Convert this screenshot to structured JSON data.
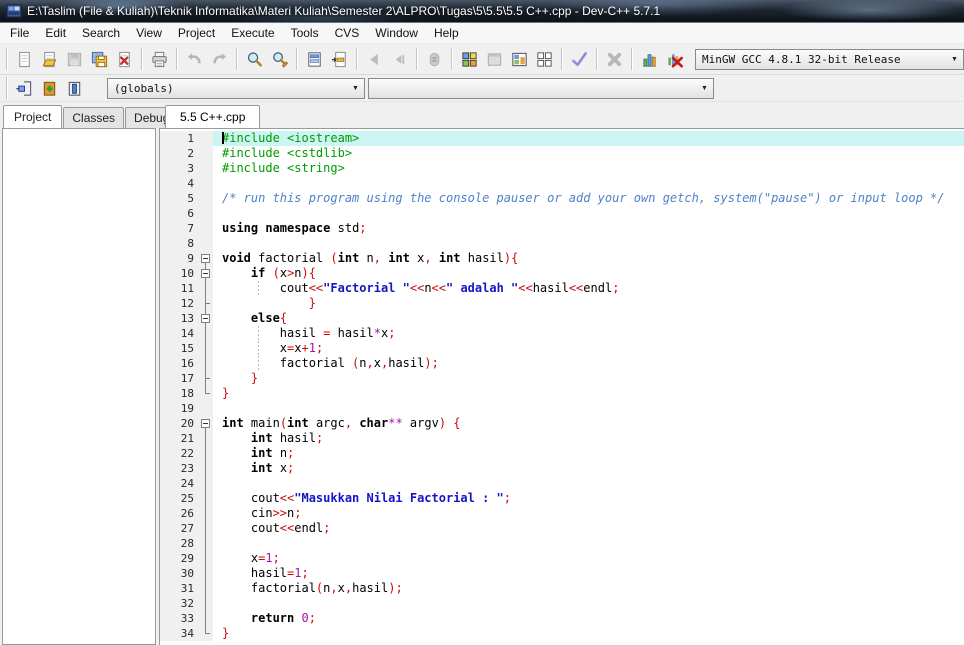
{
  "window": {
    "title": "E:\\Taslim (File & Kuliah)\\Teknik Informatika\\Materi Kuliah\\Semester 2\\ALPRO\\Tugas\\5\\5.5\\5.5 C++.cpp - Dev-C++ 5.7.1"
  },
  "menu": {
    "items": [
      "File",
      "Edit",
      "Search",
      "View",
      "Project",
      "Execute",
      "Tools",
      "CVS",
      "Window",
      "Help"
    ]
  },
  "toolbar": {
    "groups": [
      [
        "new-file-icon",
        "open-file-icon",
        "save-icon",
        "save-all-icon",
        "close-file-icon"
      ],
      [
        "print-icon"
      ],
      [
        "undo-icon",
        "redo-icon"
      ],
      [
        "find-icon",
        "replace-icon"
      ],
      [
        "goto-line-icon",
        "insert-icon"
      ],
      [
        "back-icon",
        "forward-icon"
      ],
      [
        "debug-icon"
      ],
      [
        "compile-icon",
        "run-icon",
        "compile-run-icon",
        "rebuild-all-icon"
      ],
      [
        "syntax-check-icon"
      ],
      [
        "abort-icon"
      ],
      [
        "profile-icon",
        "delete-profiling-icon"
      ]
    ],
    "compiler_select": "MinGW GCC 4.8.1 32-bit Release"
  },
  "project_toolbar": {
    "groups": [
      [
        "new-source-icon",
        "add-to-project-icon",
        "remove-from-project-icon"
      ]
    ]
  },
  "class_browser": {
    "scope": "(globals)",
    "member": ""
  },
  "panel_tabs": [
    {
      "label": "Project",
      "active": true
    },
    {
      "label": "Classes",
      "active": false
    },
    {
      "label": "Debug",
      "active": false
    }
  ],
  "editor_tabs": [
    {
      "label": "5.5 C++.cpp",
      "active": true
    }
  ],
  "colors": {
    "gutter_bg": "#f0f0f0",
    "active_line_bg": "#ccf4f2",
    "line_number": "#282828",
    "fold_mark": "#808080",
    "syntax_preprocessor": "#009b00",
    "syntax_comment": "#4f81c9",
    "syntax_keyword": "#000000",
    "syntax_string": "#1414c8",
    "syntax_operator": "#cc0a0a",
    "syntax_number": "#a810a8"
  },
  "editor": {
    "lines": [
      {
        "hl": true,
        "caret": true,
        "s": [
          [
            "pp",
            "#include <iostream>"
          ]
        ]
      },
      {
        "s": [
          [
            "pp",
            "#include <cstdlib>"
          ]
        ]
      },
      {
        "s": [
          [
            "pp",
            "#include <string>"
          ]
        ]
      },
      {
        "s": []
      },
      {
        "s": [
          [
            "cm",
            "/* run this program using the console pauser or add your own getch, system(\"pause\") or input loop */"
          ]
        ]
      },
      {
        "s": []
      },
      {
        "s": [
          [
            "kw",
            "using"
          ],
          [
            "pl",
            " "
          ],
          [
            "kw",
            "namespace"
          ],
          [
            "pl",
            " std"
          ],
          [
            "op",
            ";"
          ]
        ]
      },
      {
        "s": []
      },
      {
        "f": "b",
        "s": [
          [
            "kw",
            "void"
          ],
          [
            "pl",
            " factorial "
          ],
          [
            "op",
            "("
          ],
          [
            "kw",
            "int"
          ],
          [
            "pl",
            " n"
          ],
          [
            "op",
            ","
          ],
          [
            "pl",
            " "
          ],
          [
            "kw",
            "int"
          ],
          [
            "pl",
            " x"
          ],
          [
            "op",
            ","
          ],
          [
            "pl",
            " "
          ],
          [
            "kw",
            "int"
          ],
          [
            "pl",
            " hasil"
          ],
          [
            "op",
            "){"
          ]
        ]
      },
      {
        "f": "b",
        "s": [
          [
            "pl",
            "    "
          ],
          [
            "kw",
            "if"
          ],
          [
            "pl",
            " "
          ],
          [
            "op",
            "("
          ],
          [
            "pl",
            "x"
          ],
          [
            "op",
            ">"
          ],
          [
            "pl",
            "n"
          ],
          [
            "op",
            "){"
          ]
        ]
      },
      {
        "f": "v",
        "g": true,
        "s": [
          [
            "pl",
            "        cout"
          ],
          [
            "op",
            "<<"
          ],
          [
            "st",
            "\"Factorial \""
          ],
          [
            "op",
            "<<"
          ],
          [
            "pl",
            "n"
          ],
          [
            "op",
            "<<"
          ],
          [
            "st",
            "\" adalah \""
          ],
          [
            "op",
            "<<"
          ],
          [
            "pl",
            "hasil"
          ],
          [
            "op",
            "<<"
          ],
          [
            "pl",
            "endl"
          ],
          [
            "op",
            ";"
          ]
        ]
      },
      {
        "f": "t",
        "s": [
          [
            "pl",
            "            "
          ],
          [
            "op",
            "}"
          ]
        ]
      },
      {
        "f": "b",
        "s": [
          [
            "pl",
            "    "
          ],
          [
            "kw",
            "else"
          ],
          [
            "op",
            "{"
          ]
        ]
      },
      {
        "f": "v",
        "g": true,
        "s": [
          [
            "pl",
            "        hasil "
          ],
          [
            "op",
            "="
          ],
          [
            "pl",
            " hasil"
          ],
          [
            "nu",
            "*"
          ],
          [
            "pl",
            "x"
          ],
          [
            "op",
            ";"
          ]
        ]
      },
      {
        "f": "v",
        "g": true,
        "s": [
          [
            "pl",
            "        x"
          ],
          [
            "op",
            "="
          ],
          [
            "pl",
            "x"
          ],
          [
            "op",
            "+"
          ],
          [
            "nu",
            "1"
          ],
          [
            "op",
            ";"
          ]
        ]
      },
      {
        "f": "v",
        "g": true,
        "s": [
          [
            "pl",
            "        factorial "
          ],
          [
            "op",
            "("
          ],
          [
            "pl",
            "n"
          ],
          [
            "op",
            ","
          ],
          [
            "pl",
            "x"
          ],
          [
            "op",
            ","
          ],
          [
            "pl",
            "hasil"
          ],
          [
            "op",
            ");"
          ]
        ]
      },
      {
        "f": "t",
        "s": [
          [
            "pl",
            "    "
          ],
          [
            "op",
            "}"
          ]
        ]
      },
      {
        "f": "e",
        "s": [
          [
            "op",
            "}"
          ]
        ]
      },
      {
        "s": []
      },
      {
        "f": "b",
        "s": [
          [
            "kw",
            "int"
          ],
          [
            "pl",
            " main"
          ],
          [
            "op",
            "("
          ],
          [
            "kw",
            "int"
          ],
          [
            "pl",
            " argc"
          ],
          [
            "op",
            ","
          ],
          [
            "pl",
            " "
          ],
          [
            "kw",
            "char"
          ],
          [
            "nu",
            "**"
          ],
          [
            "pl",
            " argv"
          ],
          [
            "op",
            ")"
          ],
          [
            "pl",
            " "
          ],
          [
            "op",
            "{"
          ]
        ]
      },
      {
        "f": "v",
        "s": [
          [
            "pl",
            "    "
          ],
          [
            "kw",
            "int"
          ],
          [
            "pl",
            " hasil"
          ],
          [
            "op",
            ";"
          ]
        ]
      },
      {
        "f": "v",
        "s": [
          [
            "pl",
            "    "
          ],
          [
            "kw",
            "int"
          ],
          [
            "pl",
            " n"
          ],
          [
            "op",
            ";"
          ]
        ]
      },
      {
        "f": "v",
        "s": [
          [
            "pl",
            "    "
          ],
          [
            "kw",
            "int"
          ],
          [
            "pl",
            " x"
          ],
          [
            "op",
            ";"
          ]
        ]
      },
      {
        "f": "v",
        "s": []
      },
      {
        "f": "v",
        "s": [
          [
            "pl",
            "    cout"
          ],
          [
            "op",
            "<<"
          ],
          [
            "st",
            "\"Masukkan Nilai Factorial : \""
          ],
          [
            "op",
            ";"
          ]
        ]
      },
      {
        "f": "v",
        "s": [
          [
            "pl",
            "    cin"
          ],
          [
            "op",
            ">>"
          ],
          [
            "pl",
            "n"
          ],
          [
            "op",
            ";"
          ]
        ]
      },
      {
        "f": "v",
        "s": [
          [
            "pl",
            "    cout"
          ],
          [
            "op",
            "<<"
          ],
          [
            "pl",
            "endl"
          ],
          [
            "op",
            ";"
          ]
        ]
      },
      {
        "f": "v",
        "s": []
      },
      {
        "f": "v",
        "s": [
          [
            "pl",
            "    x"
          ],
          [
            "op",
            "="
          ],
          [
            "nu",
            "1"
          ],
          [
            "op",
            ";"
          ]
        ]
      },
      {
        "f": "v",
        "s": [
          [
            "pl",
            "    hasil"
          ],
          [
            "op",
            "="
          ],
          [
            "nu",
            "1"
          ],
          [
            "op",
            ";"
          ]
        ]
      },
      {
        "f": "v",
        "s": [
          [
            "pl",
            "    factorial"
          ],
          [
            "op",
            "("
          ],
          [
            "pl",
            "n"
          ],
          [
            "op",
            ","
          ],
          [
            "pl",
            "x"
          ],
          [
            "op",
            ","
          ],
          [
            "pl",
            "hasil"
          ],
          [
            "op",
            ");"
          ]
        ]
      },
      {
        "f": "v",
        "s": []
      },
      {
        "f": "v",
        "s": [
          [
            "pl",
            "    "
          ],
          [
            "kw",
            "return"
          ],
          [
            "pl",
            " "
          ],
          [
            "nu",
            "0"
          ],
          [
            "op",
            ";"
          ]
        ]
      },
      {
        "f": "e",
        "s": [
          [
            "op",
            "}"
          ]
        ]
      }
    ]
  }
}
